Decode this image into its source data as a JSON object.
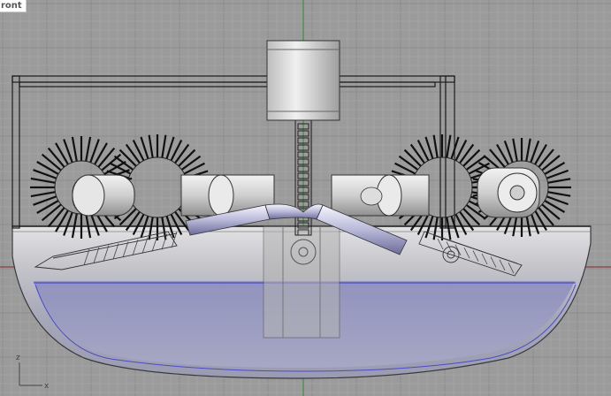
{
  "viewport": {
    "name": "Front",
    "label_visible": "ront",
    "background": "#9b9b9b",
    "grid_minor": "#a3a3a3",
    "grid_major": "#8d8d8d",
    "x_axis_color": "#8a2a2a",
    "z_axis_color": "#2e8b2e",
    "cplane": {
      "x_label": "x",
      "z_label": "z"
    }
  },
  "model": {
    "description_colors": {
      "hull": "#c9c9cc",
      "water": "#7d7fb5",
      "water_line": "#4b4bc8",
      "wire": "#1a1a1a",
      "cylinder": "#dcdcdc"
    }
  }
}
